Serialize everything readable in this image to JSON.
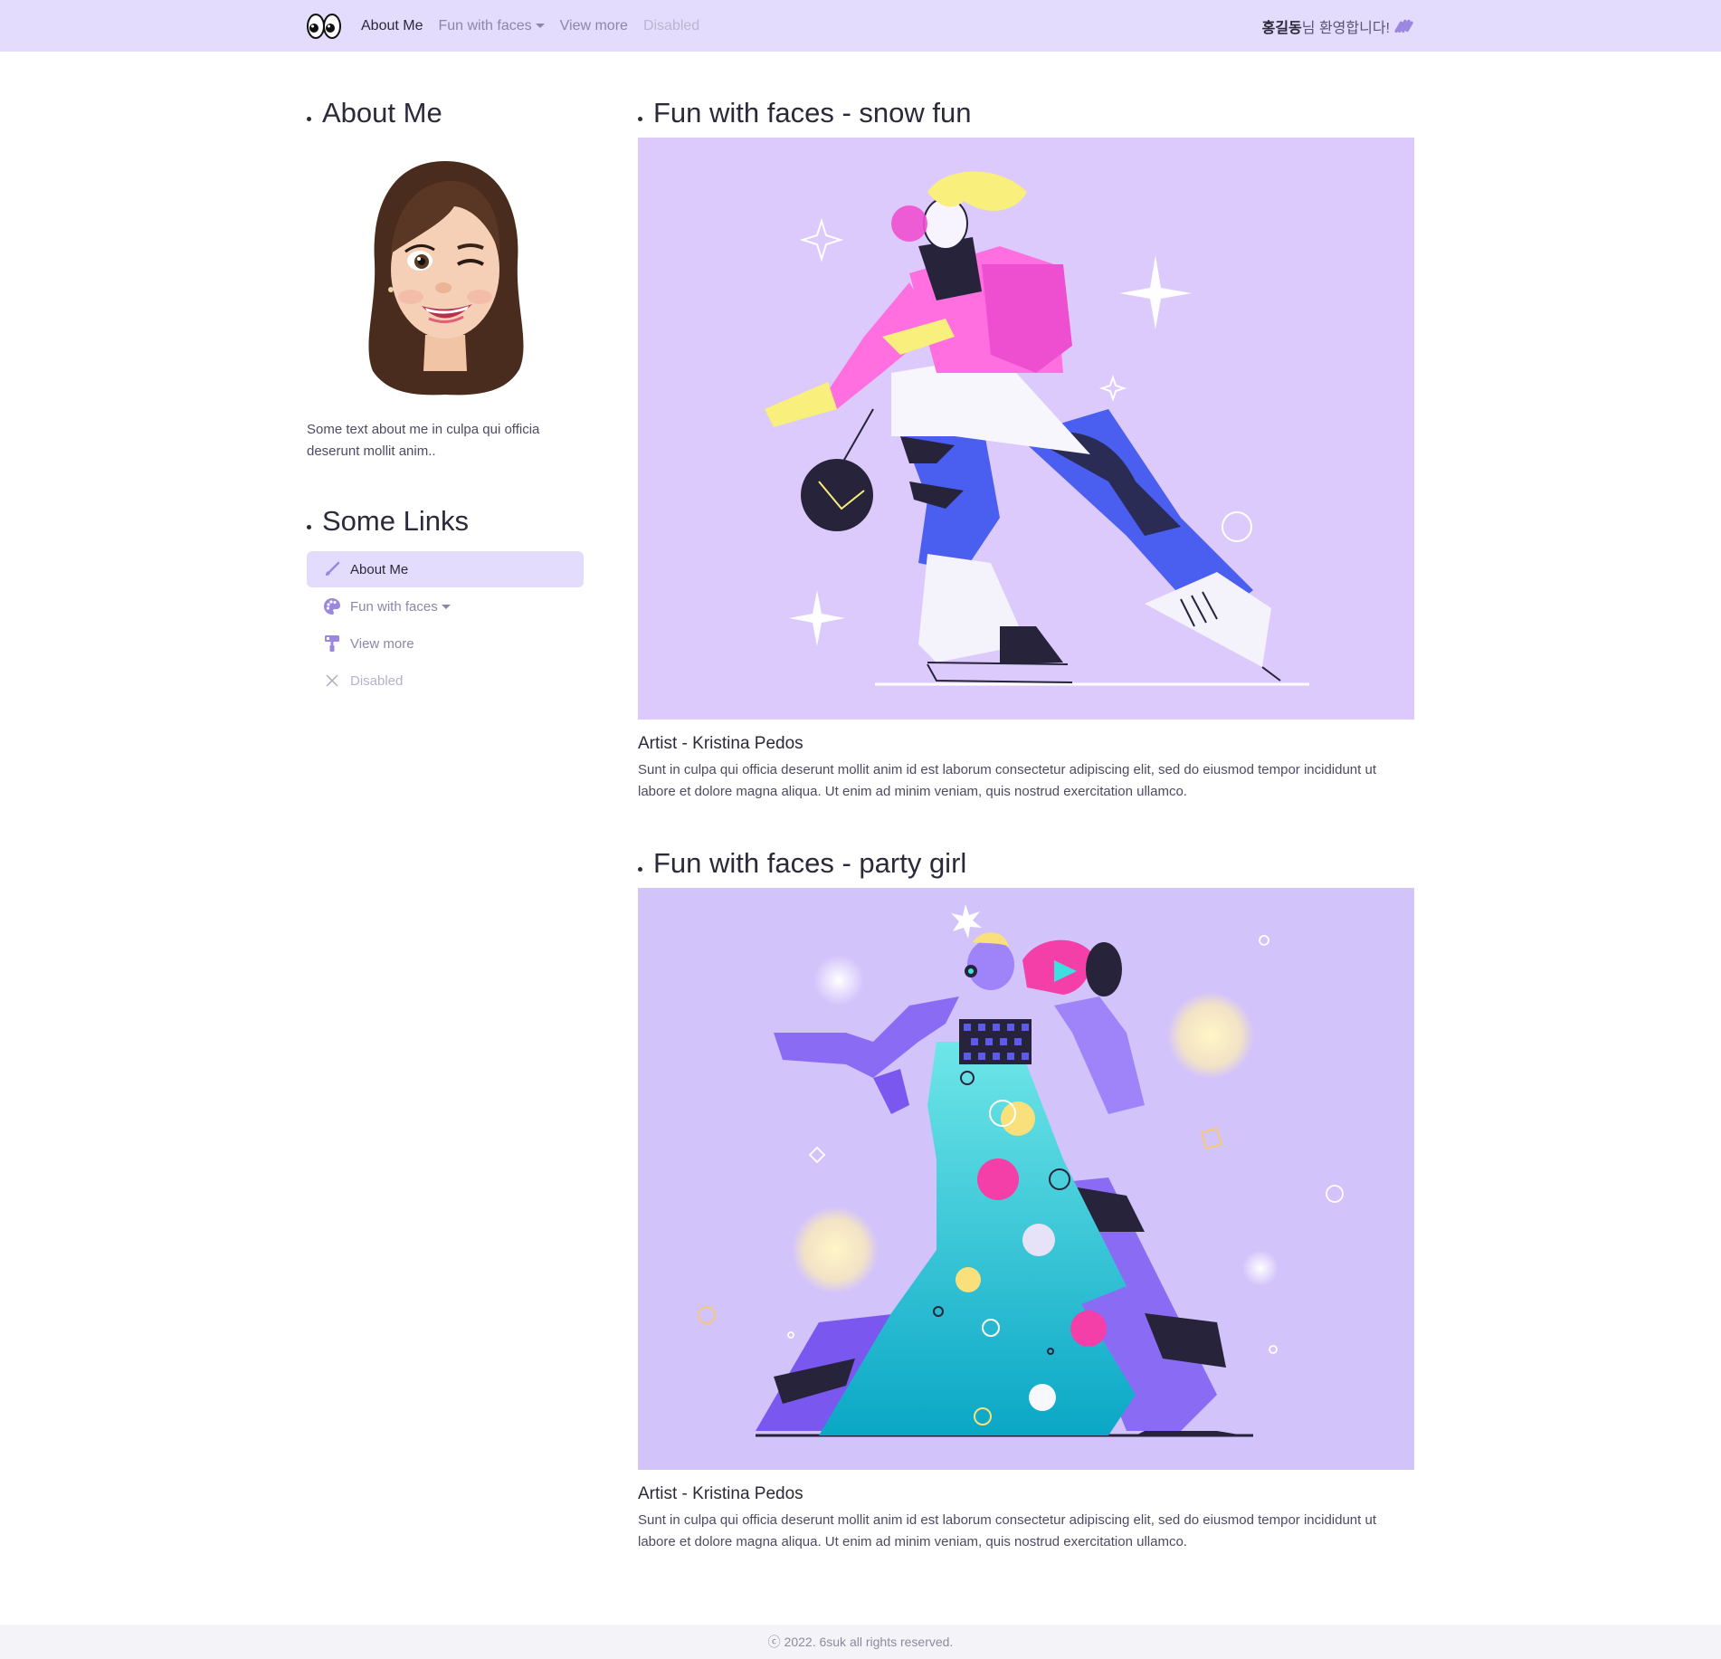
{
  "navbar": {
    "brand_icon": "eyes-icon",
    "links": [
      {
        "label": "About Me",
        "state": "active"
      },
      {
        "label": "Fun with faces",
        "state": "dropdown"
      },
      {
        "label": "View more",
        "state": "normal"
      },
      {
        "label": "Disabled",
        "state": "disabled"
      }
    ],
    "welcome_name": "홍길동",
    "welcome_suffix": "님 환영합니다!",
    "welcome_icon": "waving-hand-icon"
  },
  "sidebar": {
    "about_title": "About Me",
    "about_text": "Some text about me in culpa qui officia deserunt mollit anim..",
    "links_title": "Some Links",
    "links": [
      {
        "label": "About Me",
        "icon": "brush-icon",
        "state": "active"
      },
      {
        "label": "Fun with faces",
        "icon": "palette-icon",
        "state": "dropdown"
      },
      {
        "label": "View more",
        "icon": "paint-roller-icon",
        "state": "normal"
      },
      {
        "label": "Disabled",
        "icon": "close-icon",
        "state": "disabled"
      }
    ]
  },
  "posts": [
    {
      "title": "Fun with faces - snow fun",
      "artist": "Artist - Kristina Pedos",
      "description": "Sunt in culpa qui officia deserunt mollit anim id est laborum consectetur adipiscing elit, sed do eiusmod tempor incididunt ut labore et dolore magna aliqua. Ut enim ad minim veniam, quis nostrud exercitation ullamco."
    },
    {
      "title": "Fun with faces - party girl",
      "artist": "Artist - Kristina Pedos",
      "description": "Sunt in culpa qui officia deserunt mollit anim id est laborum consectetur adipiscing elit, sed do eiusmod tempor incididunt ut labore et dolore magna aliqua. Ut enim ad minim veniam, quis nostrud exercitation ullamco."
    }
  ],
  "footer": {
    "text": "ⓒ 2022. 6suk all rights reserved."
  },
  "colors": {
    "navbar_bg": "#e4dcfd",
    "accent": "#9b87e0",
    "image_bg": "#dccafc",
    "footer_bg": "#f4f3f7"
  }
}
